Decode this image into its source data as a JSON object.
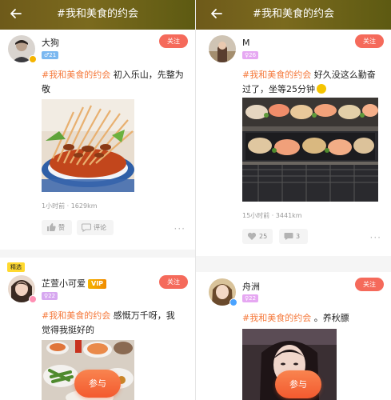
{
  "left": {
    "header": {
      "title": "#我和美食的约会"
    },
    "post1": {
      "user": "大狗",
      "level": "♂21",
      "follow": "关注",
      "tag": "#我和美食的约会",
      "text": " 初入乐山，先整为敬",
      "time_location": "1小时前 · 1629km",
      "like": "赞",
      "comment": "评论",
      "more": "···"
    },
    "post2": {
      "featured": "精选",
      "user": "芷萱小可爱",
      "vip": "VIP",
      "level": "♀22",
      "follow": "关注",
      "tag": "#我和美食的约会",
      "text": " 感慨万千呀，我觉得我挺好的"
    },
    "join": "参与"
  },
  "right": {
    "header": {
      "title": "#我和美食的约会"
    },
    "post1": {
      "user": "M",
      "level": "♀26",
      "follow": "关注",
      "tag": "#我和美食的约会",
      "text": " 好久没这么勤奋过了，坐等25分钟",
      "time_location": "15小时前 · 3441km",
      "likes": "25",
      "comments": "3",
      "more": "···"
    },
    "post2": {
      "user": "舟洲",
      "level": "♀22",
      "follow": "关注",
      "tag": "#我和美食的约会",
      "text": " 。养秋膘"
    },
    "join": "参与"
  },
  "colors": {
    "accent": "#f5793b",
    "follow": "#f56a5b",
    "header_dark": "#6e5a1a",
    "featured": "#ffd92f"
  },
  "icons": [
    "back-arrow-icon",
    "thumbs-up-icon",
    "comment-icon",
    "heart-icon",
    "more-dots-icon",
    "vip-badge-icon"
  ]
}
